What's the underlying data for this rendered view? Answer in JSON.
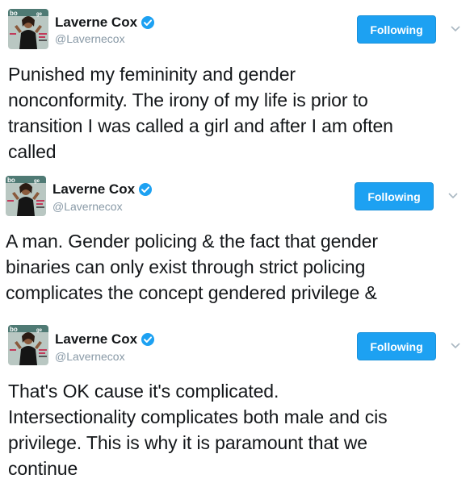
{
  "tweets": [
    {
      "display_name": "Laverne Cox",
      "handle": "@Lavernecox",
      "follow_label": "Following",
      "avatar_icon": "profile-photo-magazine-cover",
      "verified_icon": "verified-badge-icon",
      "lines": [
        "Punished my femininity and gender",
        "nonconformity. The irony of my life is prior to",
        "transition I was called a girl and after I am often",
        "called"
      ]
    },
    {
      "display_name": "Laverne Cox",
      "handle": "@Lavernecox",
      "follow_label": "Following",
      "avatar_icon": "profile-photo-magazine-cover",
      "verified_icon": "verified-badge-icon",
      "lines": [
        "A man. Gender policing & the fact that gender",
        "binaries can only exist through strict policing",
        "complicates the concept gendered privilege &"
      ]
    },
    {
      "display_name": "Laverne Cox",
      "handle": "@Lavernecox",
      "follow_label": "Following",
      "avatar_icon": "profile-photo-magazine-cover",
      "verified_icon": "verified-badge-icon",
      "lines": [
        "That's OK cause it's complicated.",
        "Intersectionality complicates both male and cis",
        "privilege. This is why it is paramount that we",
        "continue"
      ]
    }
  ],
  "colors": {
    "accent": "#1da1f2",
    "text": "#14171a",
    "muted": "#8899a6"
  }
}
